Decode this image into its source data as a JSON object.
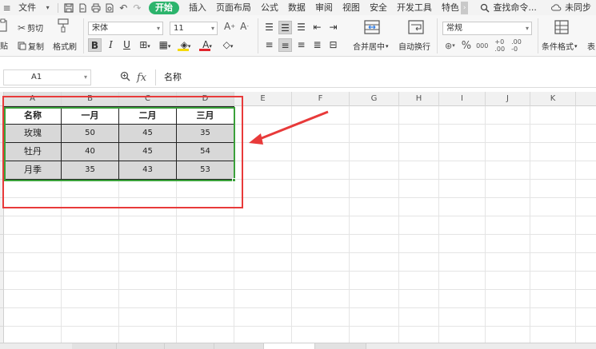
{
  "menubar": {
    "file_label": "文件",
    "start_tab": "开始",
    "tabs": [
      "插入",
      "页面布局",
      "公式",
      "数据",
      "审阅",
      "视图",
      "安全",
      "开发工具",
      "特色"
    ],
    "search_label": "查找命令...",
    "sync_label": "未同步"
  },
  "ribbon": {
    "cut_label": "剪切",
    "paste_label": "贴",
    "copy_label": "复制",
    "format_painter_label": "格式刷",
    "font_name": "宋体",
    "font_size": "11",
    "merge_center_label": "合并居中",
    "wrap_text_label": "自动换行",
    "number_format": "常规",
    "conditional_format_label": "条件格式",
    "table_style_label": "表"
  },
  "formula_bar": {
    "cell_ref": "A1",
    "fx_label": "fx",
    "formula": "名称"
  },
  "columns": [
    "A",
    "B",
    "C",
    "D",
    "E",
    "F",
    "G",
    "H",
    "I",
    "J",
    "K"
  ],
  "table": {
    "headers": [
      "名称",
      "一月",
      "二月",
      "三月"
    ],
    "rows": [
      [
        "玫瑰",
        "50",
        "45",
        "35"
      ],
      [
        "牡丹",
        "40",
        "45",
        "54"
      ],
      [
        "月季",
        "35",
        "43",
        "53"
      ]
    ]
  },
  "colors": {
    "accent_green": "#2cb46c",
    "selection_green": "#3aa13a",
    "annotation_red": "#e83a3a",
    "body_fill": "#d8d8d8"
  }
}
